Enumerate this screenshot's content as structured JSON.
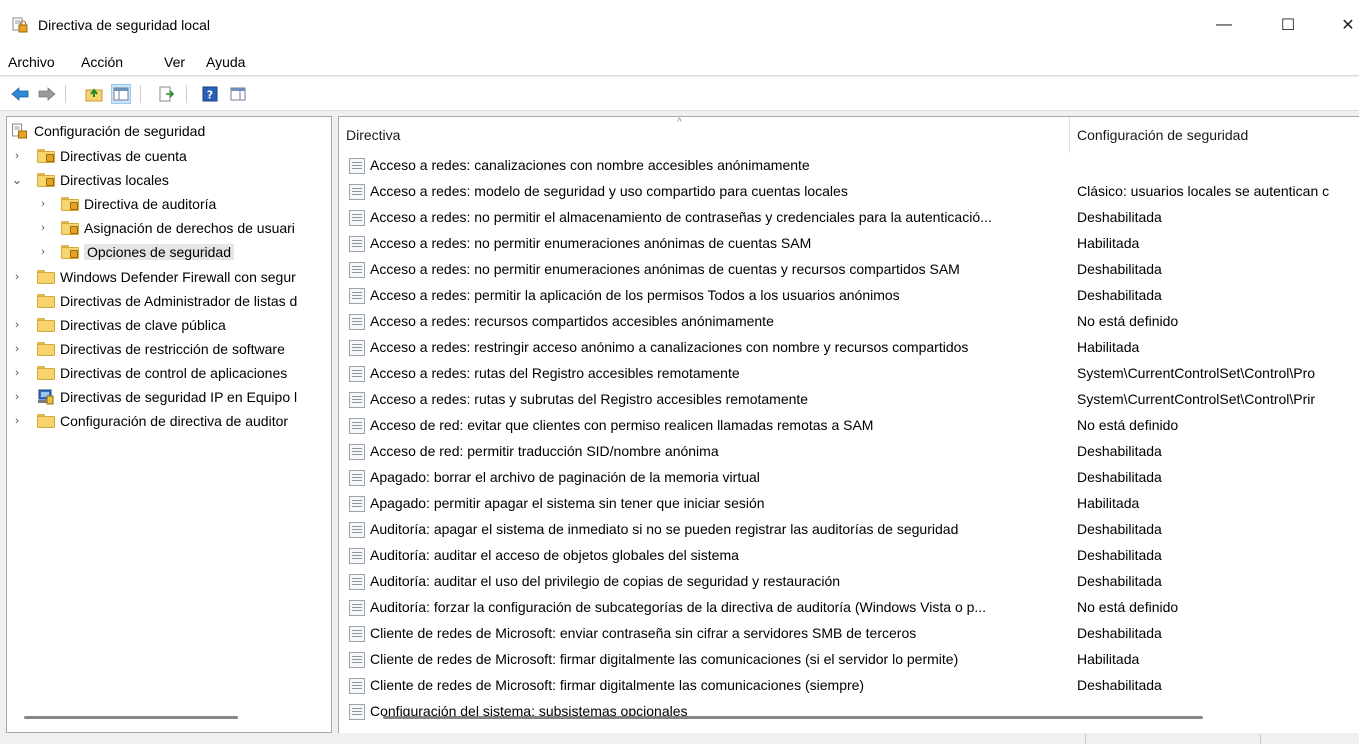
{
  "window": {
    "title": "Directiva de seguridad local",
    "minimize_glyph": "—",
    "maximize_glyph": "☐",
    "close_glyph": "✕"
  },
  "menu": [
    "Archivo",
    "Acción",
    "Ver",
    "Ayuda"
  ],
  "toolbar": {
    "icons": [
      "back-arrow-icon",
      "forward-arrow-icon",
      "up-folder-icon",
      "show-hide-tree-icon",
      "export-list-icon",
      "help-icon",
      "properties-pane-icon"
    ]
  },
  "tree": {
    "root": "Configuración de seguridad",
    "items": [
      {
        "label": "Directivas de cuenta",
        "expand": "›"
      },
      {
        "label": "Directivas locales",
        "expand": "⌄"
      },
      {
        "label": "Directiva de auditoría",
        "expand": "›"
      },
      {
        "label": "Asignación de derechos de usuari",
        "expand": "›"
      },
      {
        "label": "Opciones de seguridad",
        "expand": "›"
      },
      {
        "label": "Windows Defender Firewall con segur",
        "expand": "›"
      },
      {
        "label": "Directivas de Administrador de listas d",
        "expand": ""
      },
      {
        "label": "Directivas de clave pública",
        "expand": "›"
      },
      {
        "label": "Directivas de restricción de software",
        "expand": "›"
      },
      {
        "label": "Directivas de control de aplicaciones",
        "expand": "›"
      },
      {
        "label": "Directivas de seguridad IP en Equipo l",
        "expand": "›"
      },
      {
        "label": "Configuración de directiva de auditor",
        "expand": "›"
      }
    ]
  },
  "list": {
    "columns": [
      "Directiva",
      "Configuración de seguridad"
    ],
    "sort_glyph": "^",
    "rows": [
      [
        "Acceso a redes: canalizaciones con nombre accesibles anónimamente",
        ""
      ],
      [
        "Acceso a redes: modelo de seguridad y uso compartido para cuentas locales",
        "Clásico: usuarios locales se autentican c"
      ],
      [
        "Acceso a redes: no permitir el almacenamiento de contraseñas y credenciales para la autenticació...",
        "Deshabilitada"
      ],
      [
        "Acceso a redes: no permitir enumeraciones anónimas de cuentas SAM",
        "Habilitada"
      ],
      [
        "Acceso a redes: no permitir enumeraciones anónimas de cuentas y recursos compartidos SAM",
        "Deshabilitada"
      ],
      [
        "Acceso a redes: permitir la aplicación de los permisos Todos a los usuarios anónimos",
        "Deshabilitada"
      ],
      [
        "Acceso a redes: recursos compartidos accesibles anónimamente",
        "No está definido"
      ],
      [
        "Acceso a redes: restringir acceso anónimo a canalizaciones con nombre y recursos compartidos",
        "Habilitada"
      ],
      [
        "Acceso a redes: rutas del Registro accesibles remotamente",
        "System\\CurrentControlSet\\Control\\Pro"
      ],
      [
        "Acceso a redes: rutas y subrutas del Registro accesibles remotamente",
        "System\\CurrentControlSet\\Control\\Prir"
      ],
      [
        "Acceso de red: evitar que clientes con permiso realicen llamadas remotas a SAM",
        "No está definido"
      ],
      [
        "Acceso de red: permitir traducción SID/nombre anónima",
        "Deshabilitada"
      ],
      [
        "Apagado: borrar el archivo de paginación de la memoria virtual",
        "Deshabilitada"
      ],
      [
        "Apagado: permitir apagar el sistema sin tener que iniciar sesión",
        "Habilitada"
      ],
      [
        "Auditoría: apagar el sistema de inmediato si no se pueden registrar las auditorías de seguridad",
        "Deshabilitada"
      ],
      [
        "Auditoría: auditar el acceso de objetos globales del sistema",
        "Deshabilitada"
      ],
      [
        "Auditoría: auditar el uso del privilegio de copias de seguridad y restauración",
        "Deshabilitada"
      ],
      [
        "Auditoría: forzar la configuración de subcategorías de la directiva de auditoría (Windows Vista o p...",
        "No está definido"
      ],
      [
        "Cliente de redes de Microsoft: enviar contraseña sin cifrar a servidores SMB de terceros",
        "Deshabilitada"
      ],
      [
        "Cliente de redes de Microsoft: firmar digitalmente las comunicaciones (si el servidor lo permite)",
        "Habilitada"
      ],
      [
        "Cliente de redes de Microsoft: firmar digitalmente las comunicaciones (siempre)",
        "Deshabilitada"
      ],
      [
        "Configuración del sistema: subsistemas opcionales",
        ""
      ]
    ]
  }
}
